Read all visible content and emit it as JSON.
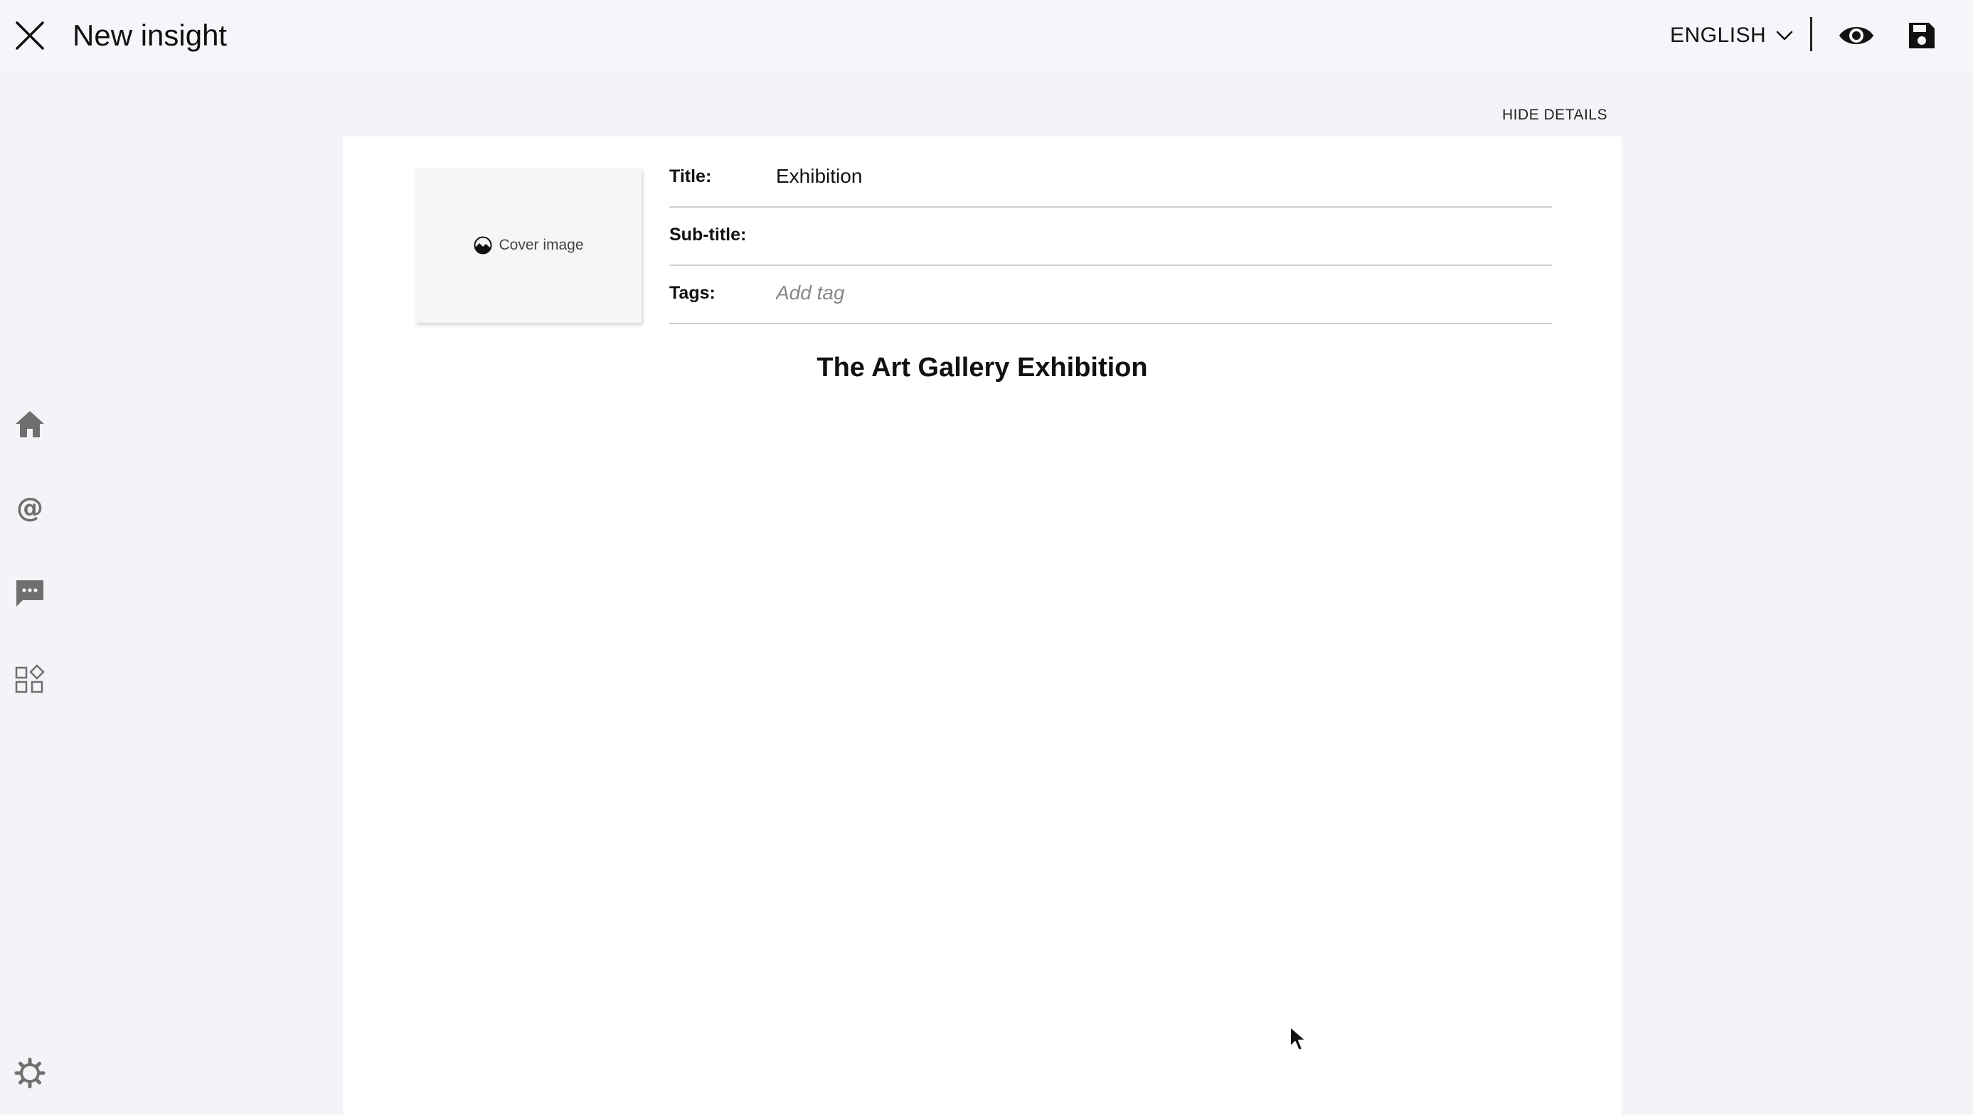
{
  "header": {
    "title": "New insight",
    "close_icon": "close-icon",
    "language": "ENGLISH",
    "language_icon": "chevron-down-icon",
    "preview_icon": "eye-icon",
    "save_icon": "save-icon"
  },
  "sidebar": {
    "items": [
      {
        "name": "home",
        "icon": "home-icon"
      },
      {
        "name": "mentions",
        "icon": "at-icon"
      },
      {
        "name": "comments",
        "icon": "chat-icon"
      },
      {
        "name": "widgets",
        "icon": "widgets-icon"
      },
      {
        "name": "settings",
        "icon": "gear-icon"
      }
    ]
  },
  "details": {
    "toggle_label": "HIDE DETAILS",
    "cover_label": "Cover image",
    "title_label": "Title:",
    "title_value": "Exhibition",
    "subtitle_label": "Sub-title:",
    "subtitle_value": "",
    "tags_label": "Tags:",
    "tags_placeholder": "Add tag"
  },
  "document": {
    "heading": "The Art Gallery Exhibition"
  },
  "colors": {
    "background": "#f3f4f7",
    "card": "#ffffff",
    "sidebar_icon": "#6f6f6f",
    "divider": "#cfcfcf"
  }
}
